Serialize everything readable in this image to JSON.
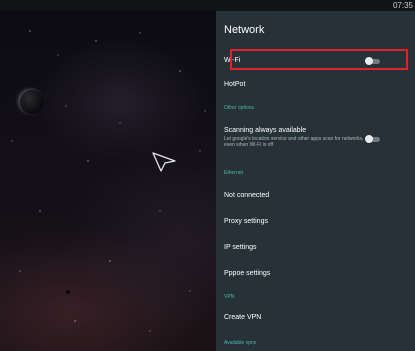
{
  "status_bar": {
    "time": "07:35"
  },
  "panel": {
    "title": "Network",
    "wifi": {
      "label": "Wi-Fi",
      "enabled": false
    },
    "hotpot": {
      "label": "HotPot"
    },
    "other_options_header": "Other options",
    "scanning": {
      "label": "Scanning always available",
      "description": "Let google's location service and other apps scan for networks, even when Wi-Fi is off",
      "enabled": false
    },
    "ethernet_header": "Ethernet",
    "ethernet_items": [
      {
        "label": "Not connected"
      },
      {
        "label": "Proxy settings"
      },
      {
        "label": "IP settings"
      },
      {
        "label": "Pppoe settings"
      }
    ],
    "vpn_header": "VPN",
    "create_vpn": {
      "label": "Create VPN"
    },
    "available_vpns_header": "Available vpns"
  },
  "colors": {
    "panel_bg": "#263238",
    "section_header": "#4db6ac",
    "highlight_border": "#e3212b"
  },
  "icons": {
    "pointer": "mouse-pointer-icon",
    "planet": "planet-icon"
  }
}
